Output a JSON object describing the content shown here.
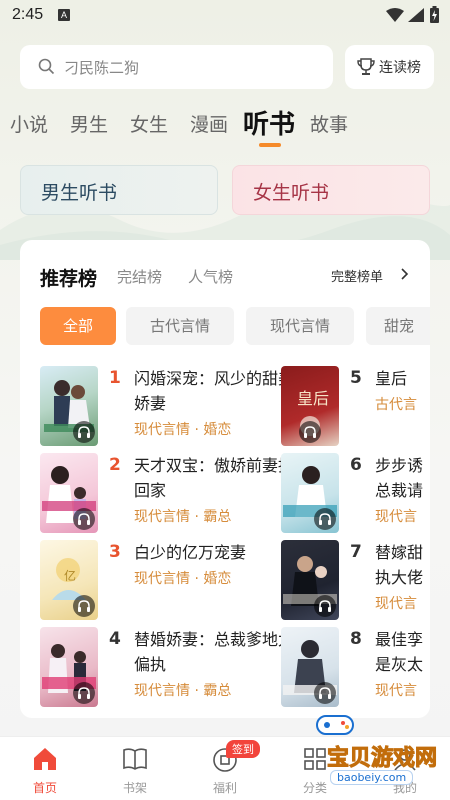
{
  "status": {
    "time": "2:45",
    "badge": "A"
  },
  "search": {
    "placeholder": "刁民陈二狗",
    "continue_label": "连读榜"
  },
  "category_tabs": [
    {
      "label": "小说",
      "active": false
    },
    {
      "label": "男生",
      "active": false
    },
    {
      "label": "女生",
      "active": false
    },
    {
      "label": "漫画",
      "active": false
    },
    {
      "label": "听书",
      "active": true
    },
    {
      "label": "故事",
      "active": false
    }
  ],
  "audio_entries": {
    "male": "男生听书",
    "female": "女生听书"
  },
  "ranking": {
    "title": "推荐榜",
    "tabs": [
      "完结榜",
      "人气榜"
    ],
    "full_list": "完整榜单",
    "chips": [
      {
        "label": "全部",
        "active": true
      },
      {
        "label": "古代言情",
        "active": false
      },
      {
        "label": "现代言情",
        "active": false
      },
      {
        "label": "甜宠",
        "active": false
      }
    ],
    "books": [
      {
        "rank": "1",
        "title": "闪婚深宠：风少的甜美娇妻",
        "tags": "现代言情 · 婚恋"
      },
      {
        "rank": "2",
        "title": "天才双宝：傲娇前妻抱回家",
        "tags": "现代言情 · 霸总"
      },
      {
        "rank": "3",
        "title": "白少的亿万宠妻",
        "tags": "现代言情 · 婚恋"
      },
      {
        "rank": "4",
        "title": "替婚娇妻：总裁爹地太偏执",
        "tags": "现代言情 · 霸总"
      },
      {
        "rank": "5",
        "title": "皇后",
        "tags": "古代言"
      },
      {
        "rank": "6",
        "title": "步步诱总裁请",
        "tags": "现代言"
      },
      {
        "rank": "7",
        "title": "替嫁甜执大佬",
        "tags": "现代言"
      },
      {
        "rank": "8",
        "title": "最佳孪是灰太",
        "tags": "现代言"
      }
    ]
  },
  "bottom_nav": [
    {
      "label": "首页",
      "active": true
    },
    {
      "label": "书架",
      "active": false
    },
    {
      "label": "福利",
      "active": false
    },
    {
      "label": "分类",
      "active": false
    },
    {
      "label": "我的",
      "active": false
    }
  ],
  "sign_badge": "签到",
  "watermark": {
    "text": "宝贝游戏网",
    "url": "baobeiy.com"
  },
  "colors": {
    "accent": "#fd8c3e",
    "rank_top": "#e8542f",
    "tag": "#d68c3b",
    "nav_active": "#f04b3a"
  }
}
